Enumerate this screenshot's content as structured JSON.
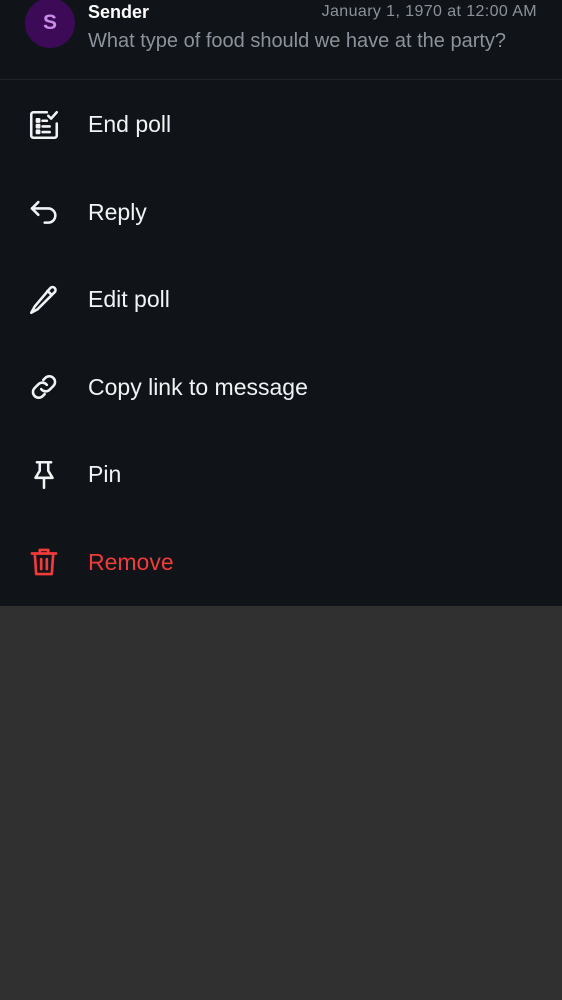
{
  "message": {
    "avatar_initial": "S",
    "sender": "Sender",
    "timestamp": "January 1, 1970 at 12:00 AM",
    "preview": "What type of food should we have at the party?"
  },
  "menu": {
    "items": [
      {
        "label": "End poll",
        "icon": "poll-check-icon"
      },
      {
        "label": "Reply",
        "icon": "reply-icon"
      },
      {
        "label": "Edit poll",
        "icon": "pencil-icon"
      },
      {
        "label": "Copy link to message",
        "icon": "link-icon"
      },
      {
        "label": "Pin",
        "icon": "pin-icon"
      },
      {
        "label": "Remove",
        "icon": "trash-icon"
      }
    ]
  },
  "colors": {
    "sheet_background": "#101318",
    "backdrop": "#303030",
    "avatar_background": "#3d0a57",
    "avatar_text": "#c98be8",
    "danger": "#ef3b3b",
    "secondary_text": "#8c929b"
  }
}
